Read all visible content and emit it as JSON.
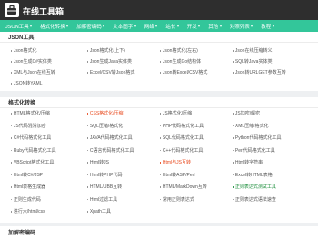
{
  "header": {
    "site_title": "在线工具箱"
  },
  "nav": [
    {
      "label": "JSON工具",
      "dropdown": true
    },
    {
      "label": "格式化转换",
      "dropdown": true
    },
    {
      "label": "加解密编码",
      "dropdown": true
    },
    {
      "label": "文本图字",
      "dropdown": true
    },
    {
      "label": "网络",
      "dropdown": true
    },
    {
      "label": "站长",
      "dropdown": true
    },
    {
      "label": "开发",
      "dropdown": true
    },
    {
      "label": "其他",
      "dropdown": true
    },
    {
      "label": "对照列表",
      "dropdown": true
    },
    {
      "label": "教程",
      "dropdown": true
    }
  ],
  "sections": [
    {
      "title": "JSON工具",
      "rows": [
        [
          {
            "text": "Json格式化"
          },
          {
            "text": "Json格式化(上下)"
          },
          {
            "text": "Json格式化(左右)"
          },
          {
            "text": "Json在线压缩转义"
          }
        ],
        [
          {
            "text": "Json生成C#实体类"
          },
          {
            "text": "Json生成Java实体类"
          },
          {
            "text": "Json生成Go结构体"
          },
          {
            "text": "SQL转Java实体类"
          }
        ],
        [
          {
            "text": "XML与Json在线互转"
          },
          {
            "text": "Excel/CSV转Json格式"
          },
          {
            "text": "Json转Excel/CSV格式"
          },
          {
            "text": "Json转URLGET参数互转"
          }
        ],
        [
          {
            "text": "JSON转YAML"
          }
        ]
      ]
    },
    {
      "title": "格式化转换",
      "rows": [
        [
          {
            "text": "HTML格式化/压缩"
          },
          {
            "text": "CSS格式化/压缩",
            "style": "red"
          },
          {
            "text": "JS格式化/压缩"
          },
          {
            "text": "JS加密/解密"
          }
        ],
        [
          {
            "text": "JS代码混淆加密"
          },
          {
            "text": "SQL压缩/格式化"
          },
          {
            "text": "PHP代码格式化工具"
          },
          {
            "text": "XML压缩/格式化"
          }
        ],
        [
          {
            "text": "C#代码格式化工具"
          },
          {
            "text": "JAVA代码格式化工具"
          },
          {
            "text": "SQL代码格式化工具"
          },
          {
            "text": "Python代码格式化工具"
          }
        ],
        [
          {
            "text": "Ruby代码格式化工具"
          },
          {
            "text": "C语言代码格式化工具"
          },
          {
            "text": "C++代码格式化工具"
          },
          {
            "text": "Perl代码格式化工具"
          }
        ],
        [
          {
            "text": "VBScript格式化工具"
          },
          {
            "text": "Html转JS"
          },
          {
            "text": "Html与JS互转",
            "style": "red"
          },
          {
            "text": "Html转字符串"
          }
        ],
        [
          {
            "text": "Html转C#/JSP"
          },
          {
            "text": "Html转PHP代码"
          },
          {
            "text": "Html转ASP/Perl"
          },
          {
            "text": "Excel转HTML表格"
          }
        ],
        [
          {
            "text": "Html表格生成器"
          },
          {
            "text": "HTML/UBB互转"
          },
          {
            "text": "HTML/MarkDown互转"
          },
          {
            "text": "正则表达式测试工具",
            "style": "green"
          }
        ],
        [
          {
            "text": "正则生成代码"
          },
          {
            "text": "Html过滤工具"
          },
          {
            "text": "常用正则表达式"
          },
          {
            "text": "正则表达式语法速查"
          }
        ],
        [
          {
            "text": "进行六/html/css"
          },
          {
            "text": "Xpath工具"
          }
        ]
      ]
    },
    {
      "title": "加解密编码",
      "rows": []
    }
  ]
}
